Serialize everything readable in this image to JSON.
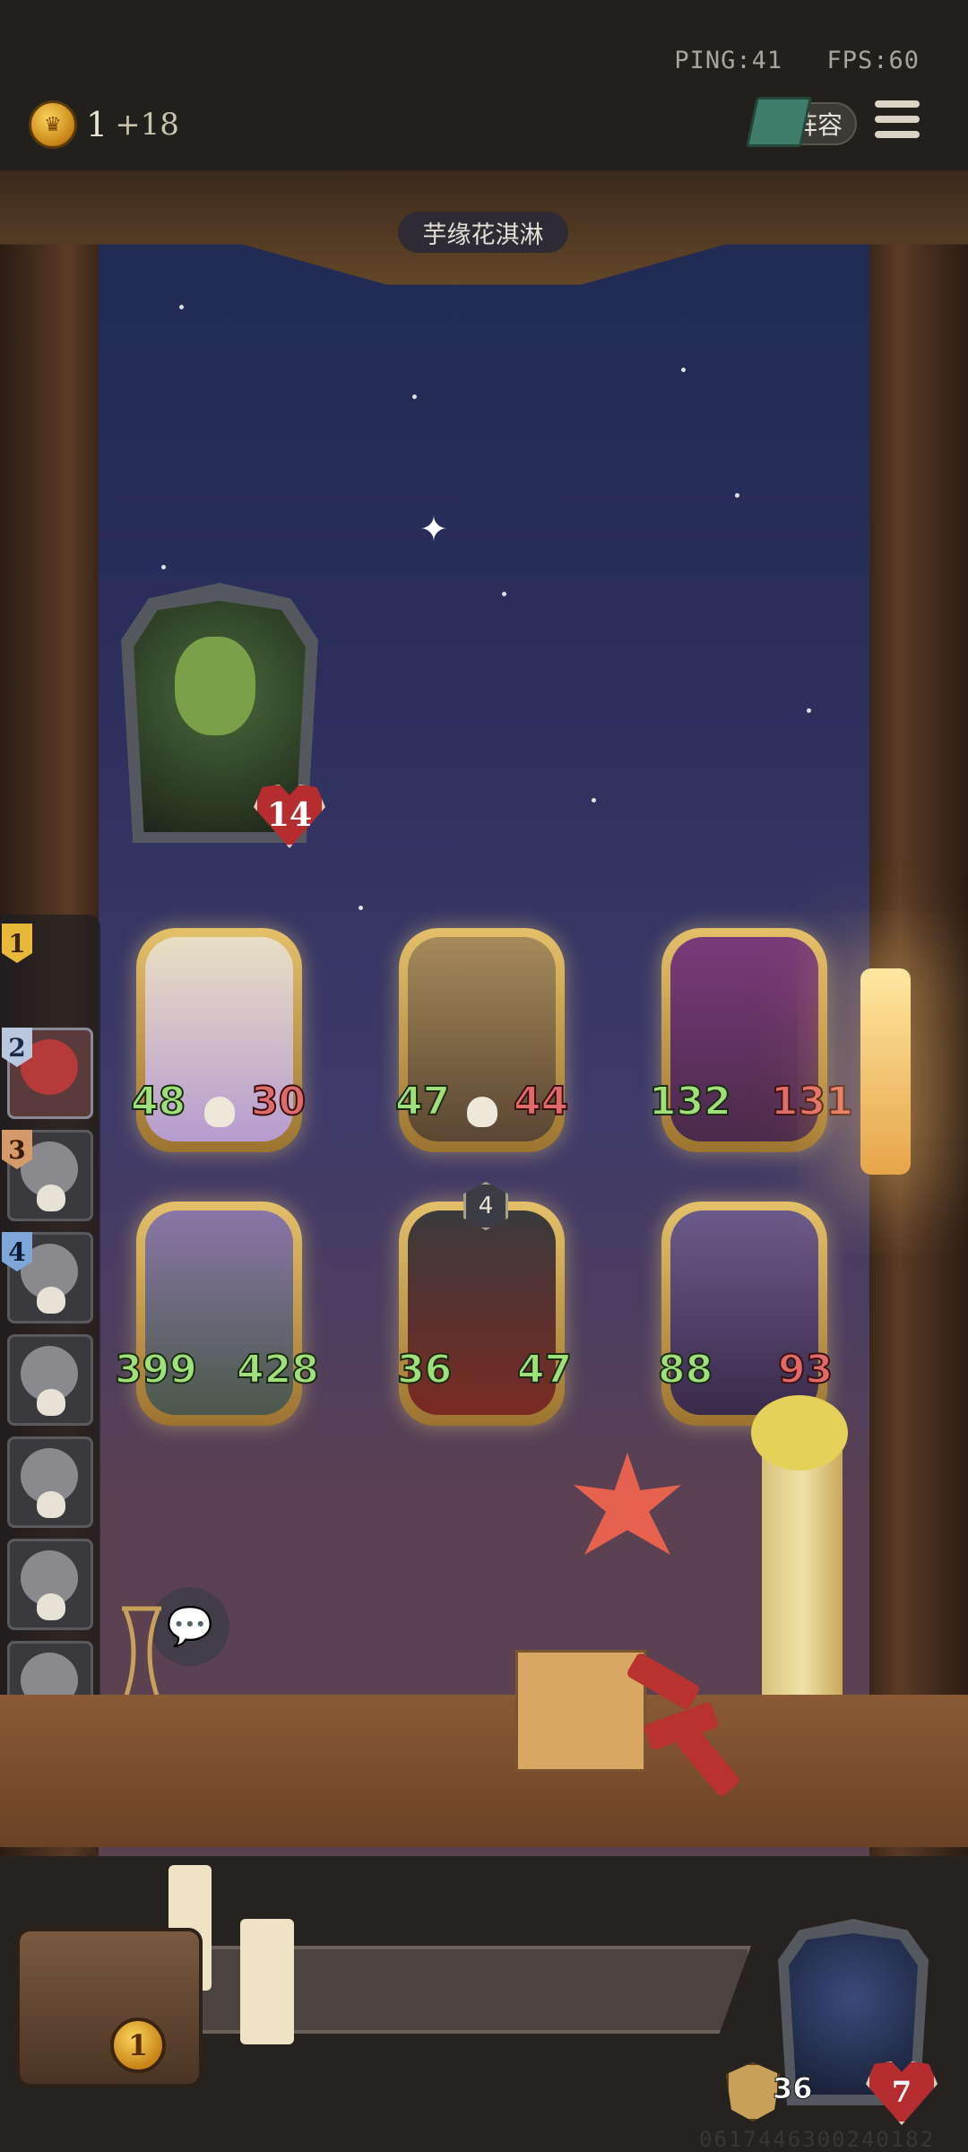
{
  "hud": {
    "ping": "PING:41",
    "fps": "FPS:60",
    "gold": "1",
    "gold_income": "+18",
    "lineup_label": "阵容",
    "menu_icon": "hamburger-menu-icon"
  },
  "opponent": {
    "name": "芋缘花淇淋",
    "health": "14"
  },
  "board": {
    "front_row": [
      {
        "attack": "48",
        "health": "30",
        "dead_marker": true
      },
      {
        "attack": "47",
        "health": "44",
        "dead_marker": true
      },
      {
        "attack": "132",
        "health": "131",
        "dead_marker": false
      }
    ],
    "back_row": [
      {
        "attack": "399",
        "health": "428",
        "tier": ""
      },
      {
        "attack": "36",
        "health": "47",
        "tier": "4"
      },
      {
        "attack": "88",
        "health": "93",
        "tier": ""
      }
    ]
  },
  "standings": {
    "ranks": [
      "1",
      "2",
      "3",
      "4"
    ]
  },
  "player": {
    "chest_level": "1",
    "armor": "36",
    "health": "7"
  },
  "footer": {
    "seed": "0617446300240182"
  },
  "colors": {
    "attack_green": "#9fe07a",
    "health_red": "#e06a6a",
    "gold_frame": "#e4c06a"
  }
}
